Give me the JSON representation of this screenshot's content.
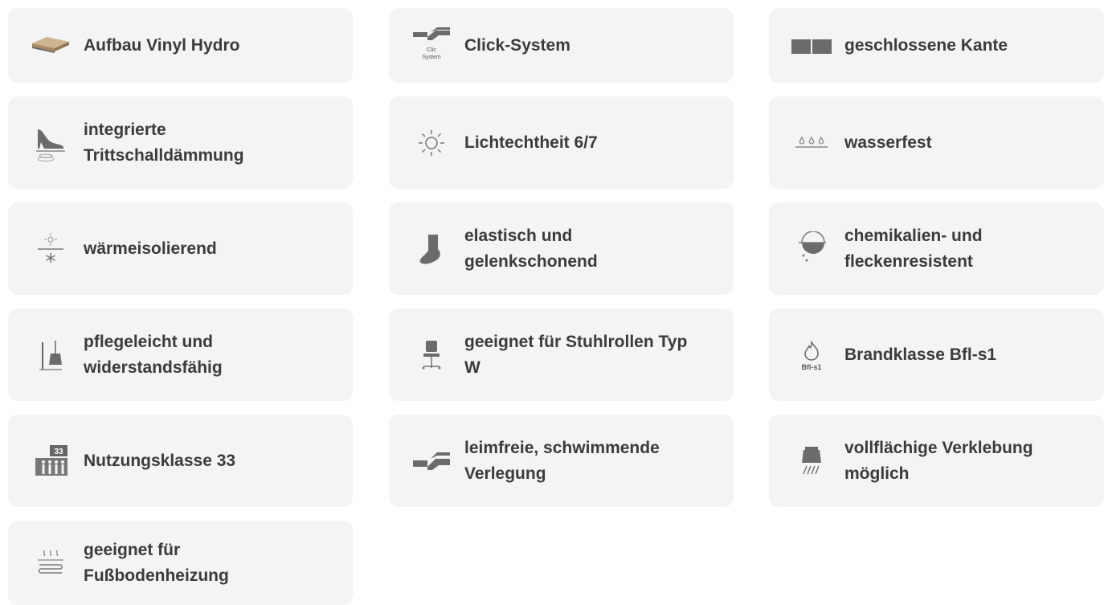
{
  "features": [
    {
      "id": "aufbau",
      "label": "Aufbau Vinyl Hydro",
      "icon": "plank-layers-icon"
    },
    {
      "id": "click",
      "label": "Click-System",
      "icon": "click-system-icon",
      "icon_text": [
        "Clic",
        "System"
      ]
    },
    {
      "id": "kante",
      "label": "geschlossene Kante",
      "icon": "closed-edge-icon"
    },
    {
      "id": "trittschall",
      "label": "integrierte Trittschalldämmung",
      "icon": "high-heel-icon"
    },
    {
      "id": "licht",
      "label": "Lichtechtheit 6/7",
      "icon": "sun-icon"
    },
    {
      "id": "wasser",
      "label": "wasserfest",
      "icon": "water-drops-icon"
    },
    {
      "id": "waerme",
      "label": "wärmeisolierend",
      "icon": "sun-snowflake-icon"
    },
    {
      "id": "elastisch",
      "label": "elastisch und gelenkschonend",
      "icon": "foot-icon"
    },
    {
      "id": "chemie",
      "label": "chemikalien- und fleckenresistent",
      "icon": "chemical-flask-icon"
    },
    {
      "id": "pflege",
      "label": "pflegeleicht und widerstandsfähig",
      "icon": "broom-icon"
    },
    {
      "id": "stuhl",
      "label": "geeignet für Stuhlrollen Typ W",
      "icon": "office-chair-icon"
    },
    {
      "id": "brand",
      "label": "Brandklasse Bfl-s1",
      "icon": "fire-class-icon",
      "icon_text": "Bfl-s1"
    },
    {
      "id": "nutzung",
      "label": "Nutzungsklasse 33",
      "icon": "usage-class-icon",
      "icon_text": "33"
    },
    {
      "id": "leimfrei",
      "label": "leimfreie, schwimmende Verlegung",
      "icon": "floating-install-icon"
    },
    {
      "id": "verklebung",
      "label": "vollflächige Verklebung möglich",
      "icon": "glue-trowel-icon"
    },
    {
      "id": "heizung",
      "label": "geeignet für Fußbodenheizung",
      "icon": "floor-heating-icon"
    }
  ],
  "colors": {
    "card_bg": "#f4f4f4",
    "text": "#3b3b3b",
    "icon": "#6b6b6b"
  }
}
